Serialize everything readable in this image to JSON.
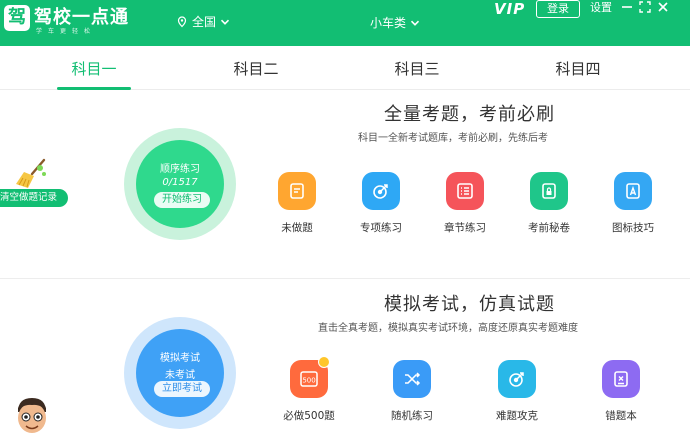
{
  "app": {
    "logo_char": "驾",
    "title": "驾校一点通",
    "subtitle": "学车更轻松",
    "region": "全国",
    "car_type": "小车类",
    "vip": "VIP",
    "login": "登录",
    "settings": "设置"
  },
  "tabs": [
    {
      "label": "科目一",
      "active": true
    },
    {
      "label": "科目二",
      "active": false
    },
    {
      "label": "科目三",
      "active": false
    },
    {
      "label": "科目四",
      "active": false
    }
  ],
  "practice": {
    "title": "全量考题，考前必刷",
    "subtitle": "科目一全新考试题库，考前必刷，先练后考",
    "circle_title": "顺序练习",
    "progress": "0/1517",
    "start_button": "开始练习",
    "clear_record": "清空做题记录",
    "features": [
      {
        "label": "未做题",
        "icon": "note-icon",
        "color": "#ffa630"
      },
      {
        "label": "专项练习",
        "icon": "target-icon",
        "color": "#2ea8f5"
      },
      {
        "label": "章节练习",
        "icon": "list-icon",
        "color": "#f5545a"
      },
      {
        "label": "考前秘卷",
        "icon": "lock-doc-icon",
        "color": "#1fc68a"
      },
      {
        "label": "图标技巧",
        "icon": "a-card-icon",
        "color": "#34a7f3"
      }
    ]
  },
  "exam": {
    "title": "模拟考试，仿真试题",
    "subtitle": "直击全真考题，模拟真实考试环境，高度还原真实考题难度",
    "circle_title": "模拟考试",
    "status": "未考试",
    "start_button": "立即考试",
    "features": [
      {
        "label": "必做500题",
        "icon": "book-500-icon",
        "color": "#ff6a3d",
        "badge": "500"
      },
      {
        "label": "随机练习",
        "icon": "shuffle-icon",
        "color": "#3a9bf7"
      },
      {
        "label": "难题攻克",
        "icon": "target-icon",
        "color": "#29b8e8"
      },
      {
        "label": "错题本",
        "icon": "x-doc-icon",
        "color": "#8d6bf2"
      }
    ]
  }
}
